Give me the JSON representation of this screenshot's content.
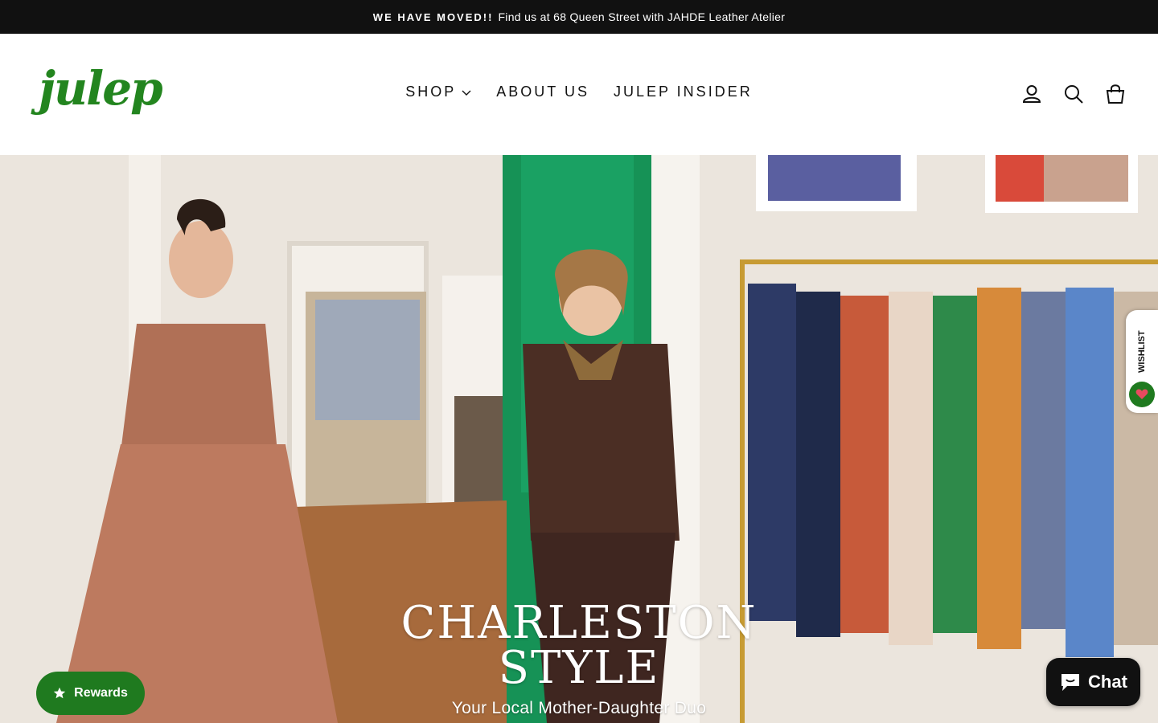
{
  "announcement": {
    "bold": "WE HAVE MOVED!!",
    "text": "Find us at 68 Queen Street with JAHDE Leather Atelier"
  },
  "header": {
    "logo": "julep",
    "nav": [
      {
        "label": "SHOP",
        "has_dropdown": true
      },
      {
        "label": "ABOUT US",
        "has_dropdown": false
      },
      {
        "label": "JULEP INSIDER",
        "has_dropdown": false
      }
    ],
    "icons": [
      "account-icon",
      "search-icon",
      "cart-icon"
    ]
  },
  "hero": {
    "title_line1": "CHARLESTON",
    "title_line2": "STYLE",
    "subtitle": "Your Local Mother-Daughter Duo"
  },
  "wishlist": {
    "label": "WISHLIST"
  },
  "rewards": {
    "label": "Rewards"
  },
  "chat": {
    "label": "Chat"
  },
  "colors": {
    "brand_green": "#23851f",
    "announcement_bg": "#111111",
    "accent_green_dark": "#1f7a1f"
  }
}
